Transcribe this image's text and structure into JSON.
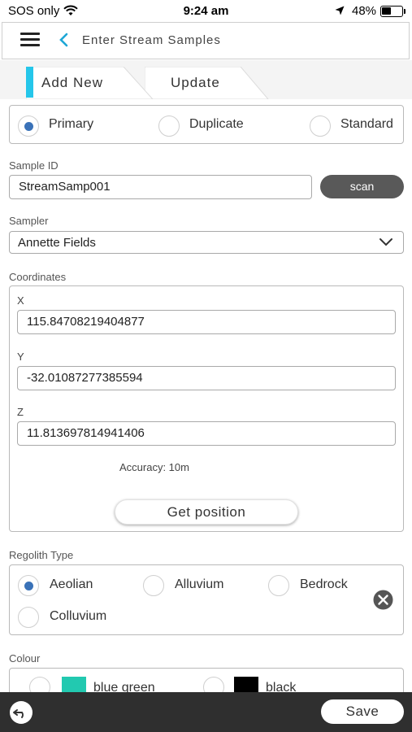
{
  "status_bar": {
    "carrier": "SOS only",
    "time": "9:24 am",
    "battery": "48%",
    "battery_level": 0.48
  },
  "header": {
    "title": "Enter Stream Samples",
    "menu_icon": "menu-icon",
    "back_icon": "back-chevron-icon"
  },
  "tabs": [
    {
      "label": "Add New",
      "active": true
    },
    {
      "label": "Update",
      "active": false
    }
  ],
  "sample_type": {
    "options": [
      "Primary",
      "Duplicate",
      "Standard"
    ],
    "selected": "Primary"
  },
  "sample_id": {
    "label": "Sample ID",
    "value": "StreamSamp001",
    "scan_label": "scan"
  },
  "sampler": {
    "label": "Sampler",
    "value": "Annette Fields"
  },
  "coordinates": {
    "label": "Coordinates",
    "x_label": "X",
    "x_value": "115.84708219404877",
    "y_label": "Y",
    "y_value": "-32.01087277385594",
    "z_label": "Z",
    "z_value": "11.813697814941406",
    "accuracy": "Accuracy: 10m",
    "get_position_label": "Get position"
  },
  "regolith": {
    "label": "Regolith Type",
    "options": [
      "Aeolian",
      "Alluvium",
      "Bedrock",
      "Colluvium"
    ],
    "selected": "Aeolian",
    "clear_icon": "clear-circle-icon"
  },
  "colour": {
    "label": "Colour",
    "options": [
      {
        "label": "blue green",
        "color": "#22c9b0"
      },
      {
        "label": "black",
        "color": "#000000"
      }
    ]
  },
  "bottom_bar": {
    "undo_icon": "undo-icon",
    "save_label": "Save"
  },
  "colors": {
    "accent": "#25c6ea",
    "radio_selected": "#3a72b8",
    "bottom_bar": "#2f2f2f"
  }
}
